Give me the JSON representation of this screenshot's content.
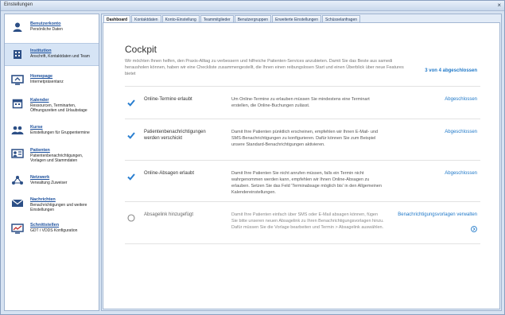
{
  "window": {
    "title": "Einstellungen",
    "close_glyph": "×"
  },
  "sidebar": {
    "items": [
      {
        "title": "Benutzerkonto",
        "desc": "Persönliche Daten",
        "icon": "user-icon"
      },
      {
        "title": "Institution",
        "desc": "Anschrift, Kontaktdaten und Team",
        "icon": "building-icon"
      },
      {
        "title": "Homepage",
        "desc": "Internetpräsentanz",
        "icon": "homepage-icon"
      },
      {
        "title": "Kalender",
        "desc": "Ressourcen, Terminarten, Öffnungszeiten und Urlaubstage",
        "icon": "calendar-icon"
      },
      {
        "title": "Kurse",
        "desc": "Einstellungen für Gruppentermine",
        "icon": "group-icon"
      },
      {
        "title": "Patienten",
        "desc": "Patientenbenachrichtigungen, Vorlagen und Stammdaten",
        "icon": "patient-card-icon"
      },
      {
        "title": "Netzwerk",
        "desc": "Verwaltung Zuweiser",
        "icon": "network-icon"
      },
      {
        "title": "Nachrichten",
        "desc": "Benachrichtigungen und weitere Einstellungen",
        "icon": "mail-icon"
      },
      {
        "title": "Schnittstellen",
        "desc": "GDT / VDDS Konfiguration",
        "icon": "interface-icon"
      }
    ]
  },
  "tabs": [
    "Dashboard",
    "Kontaktdaten",
    "Konto-Einstellung",
    "Teammitglieder",
    "Benutzergruppen",
    "Erweiterte Einstellungen",
    "Schüsselanfragen"
  ],
  "cockpit": {
    "title": "Cockpit",
    "intro": "Wir möchten Ihnen helfen, den Praxis-Alltag zu verbessern und hilfreiche Patienten-Services anzubieten. Damit Sie das Beste aus samedi herausholen können, haben wir eine Checkliste zusammengestellt, die Ihnen einen reibungslosen Start und einen Überblick über neue Features bietet",
    "progress": "3 von 4 abgeschlossen",
    "items": [
      {
        "label": "Online-Termine erlaubt",
        "desc": "Um Online-Termine zu erlauben müssen Sie mindestens eine Terminart erstellen, die Online-Buchungen zulässt.",
        "link": "Abgeschlossen",
        "done": true
      },
      {
        "label": "Patientenbenachrichtigungen werden verschickt",
        "desc": "Damit Ihre Patienten pünktlich erscheinen, empfehlen wir Ihnen E-Mail- und SMS-Benachrichtigungen zu konfigurieren. Dafür können Sie zum Beispiel unsere Standard-Benachrichtigungen aktivieren.",
        "link": "Abgeschlossen",
        "done": true
      },
      {
        "label": "Online-Absagen erlaubt",
        "desc": "Damit Ihre Patienten Sie nicht anrufen müssen, falls ein Termin nicht wahrgenommen werden kann, empfehlen wir Ihnen Online-Absagen zu erlauben. Setzen Sie das Feld 'Terminabsage möglich bis' in den Allgemeinen Kalendereinstellungen.",
        "link": "Abgeschlossen",
        "done": true
      },
      {
        "label": "Absagelink hinzugefügt",
        "desc": "Damit Ihre Patienten einfach über SMS oder E-Mail absagen können, fügen Sie bitte unseren neuen Absagelink zu Ihren Benachrichtigungsvorlagen hinzu. Dafür müssen Sie die Vorlage bearbeiten und Termin > Absagelink auswählen.",
        "link": "Benachrichtigungsvorlagen verwalten",
        "done": false
      }
    ]
  },
  "colors": {
    "accent": "#1f78c8",
    "check": "#2a7fd0",
    "nav_link": "#1b4f9c"
  }
}
